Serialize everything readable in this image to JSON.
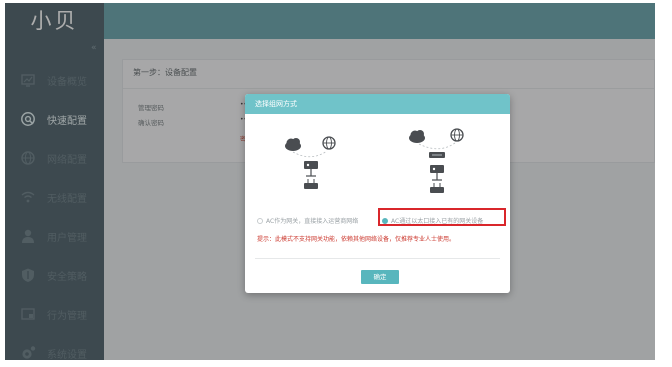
{
  "app": {
    "logo": "小贝"
  },
  "sidebar": {
    "collapse_glyph": "«",
    "items": [
      {
        "label": "设备概览",
        "icon": "monitor-icon",
        "active": false
      },
      {
        "label": "快速配置",
        "icon": "quick-config-icon",
        "active": true
      },
      {
        "label": "网络配置",
        "icon": "globe-icon",
        "active": false
      },
      {
        "label": "无线配置",
        "icon": "wifi-icon",
        "active": false
      },
      {
        "label": "用户管理",
        "icon": "user-icon",
        "active": false
      },
      {
        "label": "安全策略",
        "icon": "shield-icon",
        "active": false
      },
      {
        "label": "行为管理",
        "icon": "behavior-icon",
        "active": false
      },
      {
        "label": "系统设置",
        "icon": "gear-icon",
        "active": false
      }
    ]
  },
  "main": {
    "title": "第一步：设备配置",
    "fields": [
      {
        "label": "管理密码",
        "value": "••"
      },
      {
        "label": "确认密码",
        "value": "••"
      }
    ],
    "error_fragment": "密"
  },
  "modal": {
    "title": "选择组网方式",
    "options": [
      {
        "label": "AC作为网关，直接接入运营商网络",
        "selected": false
      },
      {
        "label": "AC通过以太口接入已有的网关设备",
        "selected": true
      }
    ],
    "tip": "提示：此模式不支持网关功能，依赖其他网络设备，仅推荐专业人士使用。",
    "confirm_label": "确定"
  },
  "colors": {
    "sidebar_bg": "#3e535d",
    "topbar_bg": "#5c9ea5",
    "modal_header": "#70c3c9",
    "accent": "#58b6bd",
    "highlight_box": "#d9262b",
    "tip_text": "#cc3a30"
  }
}
